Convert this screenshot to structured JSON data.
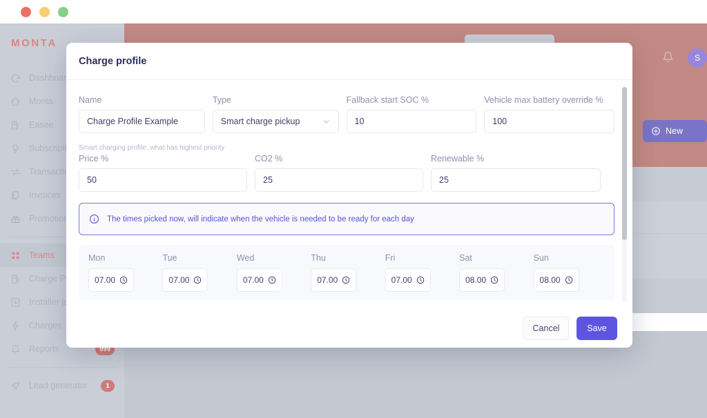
{
  "window": {
    "traffic_lights": [
      "close",
      "minimize",
      "maximize"
    ]
  },
  "app": {
    "brand": "MONTA",
    "topbar": {
      "bell_icon": "bell-icon",
      "avatar_initial": "S",
      "new_button_label": "New",
      "new_button_icon": "plus-circle-icon"
    },
    "sidebar": {
      "items": [
        {
          "label": "Dashboard",
          "icon": "dashboard-icon",
          "active": false,
          "badge": ""
        },
        {
          "label": "Monta",
          "icon": "home-icon",
          "active": false,
          "badge": ""
        },
        {
          "label": "Easee",
          "icon": "charger-icon",
          "active": false,
          "badge": ""
        },
        {
          "label": "Subscriptions",
          "icon": "bulb-icon",
          "active": false,
          "badge": ""
        },
        {
          "label": "Transactions",
          "icon": "transfer-icon",
          "active": false,
          "badge": ""
        },
        {
          "label": "Invoices",
          "icon": "invoice-icon",
          "active": false,
          "badge": ""
        },
        {
          "label": "Promotion codes",
          "icon": "gift-icon",
          "active": false,
          "badge": ""
        },
        {
          "label": "Teams",
          "icon": "grid-icon",
          "active": true,
          "badge": ""
        },
        {
          "label": "Charge Points",
          "icon": "charger-icon",
          "active": false,
          "badge": ""
        },
        {
          "label": "Installer jobs",
          "icon": "download-icon",
          "active": false,
          "badge": ""
        },
        {
          "label": "Charges",
          "icon": "bolt-icon",
          "active": false,
          "badge": ""
        },
        {
          "label": "Reports",
          "icon": "alarm-icon",
          "active": false,
          "badge": "999"
        },
        {
          "label": "Lead generator",
          "icon": "send-icon",
          "active": false,
          "badge": "1"
        }
      ]
    }
  },
  "modal": {
    "title": "Charge profile",
    "fields": {
      "name": {
        "label": "Name",
        "value": "Charge Profile Example",
        "placeholder": "Name"
      },
      "type": {
        "label": "Type",
        "value": "Smart charge pickup",
        "icon": "chevron-down-icon"
      },
      "fallback_soc": {
        "label": "Fallback start SOC %",
        "value": "10",
        "placeholder": "0"
      },
      "vehicle_max": {
        "label": "Vehicle max battery override %",
        "value": "100",
        "placeholder": "0"
      }
    },
    "priority_hint": "Smart charging profile, what has highest priority",
    "priority_fields": {
      "price": {
        "label": "Price %",
        "value": "50",
        "placeholder": "0"
      },
      "co2": {
        "label": "CO2 %",
        "value": "25",
        "placeholder": "0"
      },
      "renewable": {
        "label": "Renewable %",
        "value": "25",
        "placeholder": "0"
      }
    },
    "info_banner": {
      "icon": "info-circle-icon",
      "text": "The times picked now, will indicate when the vehicle is needed to be ready for each day"
    },
    "days": [
      {
        "label": "Mon",
        "time": "07.00",
        "icon": "clock-icon"
      },
      {
        "label": "Tue",
        "time": "07.00",
        "icon": "clock-icon"
      },
      {
        "label": "Wed",
        "time": "07.00",
        "icon": "clock-icon"
      },
      {
        "label": "Thu",
        "time": "07.00",
        "icon": "clock-icon"
      },
      {
        "label": "Fri",
        "time": "07.00",
        "icon": "clock-icon"
      },
      {
        "label": "Sat",
        "time": "08.00",
        "icon": "clock-icon"
      },
      {
        "label": "Sun",
        "time": "08.00",
        "icon": "clock-icon"
      }
    ],
    "footer": {
      "cancel_label": "Cancel",
      "save_label": "Save"
    }
  },
  "colors": {
    "brand_red": "#c4564f",
    "topbar_red": "#a9564f",
    "accent_purple": "#5d55e0",
    "new_button_blue": "#4039ac",
    "badge_red": "#b9433f"
  }
}
